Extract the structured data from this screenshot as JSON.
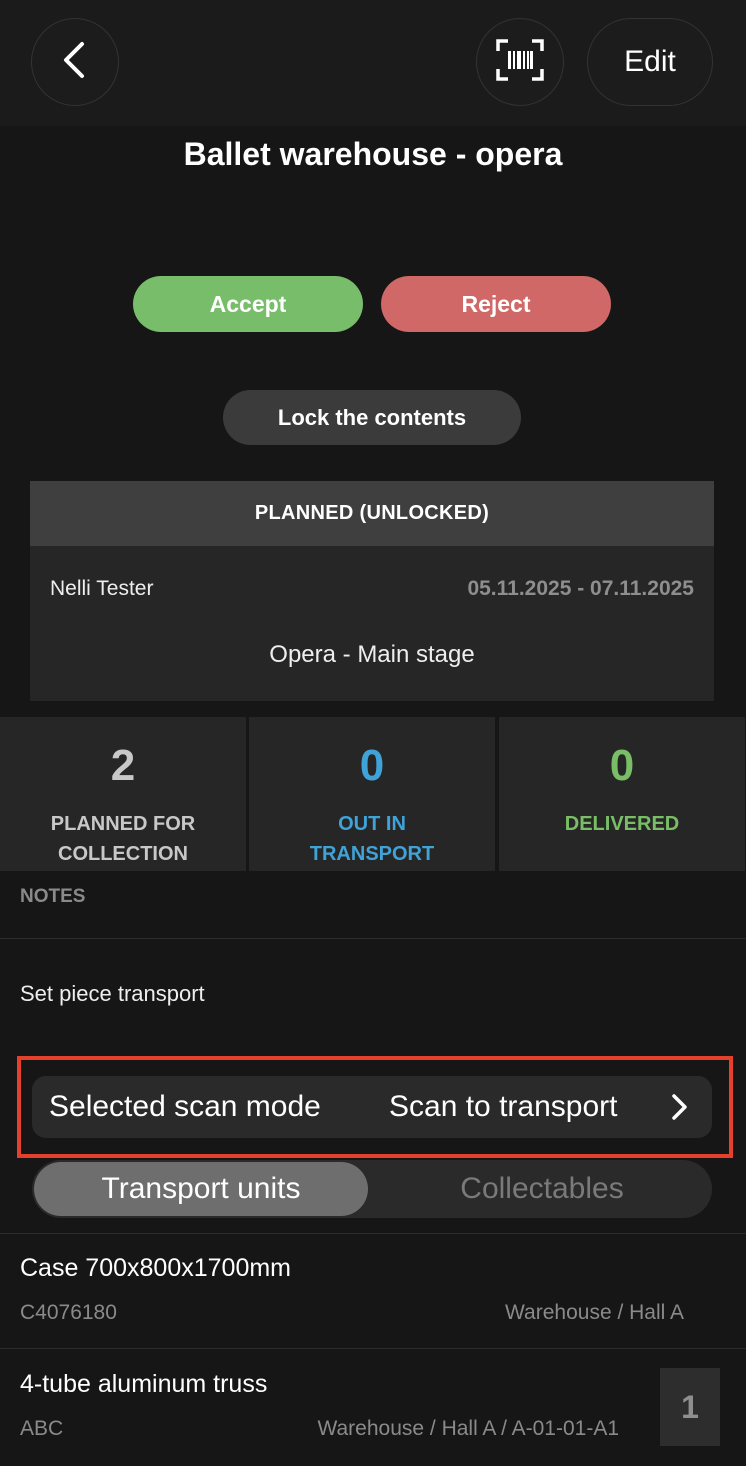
{
  "header": {
    "edit_label": "Edit",
    "title": "Ballet warehouse - opera"
  },
  "actions": {
    "accept_label": "Accept",
    "reject_label": "Reject",
    "lock_label": "Lock the contents"
  },
  "plan": {
    "status": "PLANNED (UNLOCKED)",
    "person": "Nelli Tester",
    "dates": "05.11.2025 - 07.11.2025",
    "location": "Opera - Main stage"
  },
  "stats": [
    {
      "value": "2",
      "label": "PLANNED FOR COLLECTION",
      "color": "#c8c8c8"
    },
    {
      "value": "0",
      "label": "OUT IN TRANSPORT",
      "color": "#3fa3d8"
    },
    {
      "value": "0",
      "label": "DELIVERED",
      "color": "#79bd66"
    }
  ],
  "notes": {
    "heading": "NOTES",
    "text": "Set piece transport"
  },
  "scan_mode": {
    "label": "Selected scan mode",
    "value": "Scan to transport"
  },
  "tabs": [
    {
      "label": "Transport units",
      "active": true
    },
    {
      "label": "Collectables",
      "active": false
    }
  ],
  "items": [
    {
      "title": "Case 700x800x1700mm",
      "code": "C4076180",
      "location": "Warehouse / Hall A"
    },
    {
      "title": "4-tube aluminum truss",
      "code": "ABC",
      "location": "Warehouse / Hall A / A-01-01-A1",
      "quantity": "1"
    }
  ],
  "colors": {
    "accent_highlight": "#e4402b",
    "accept": "#78bd6a",
    "reject": "#d06868"
  }
}
